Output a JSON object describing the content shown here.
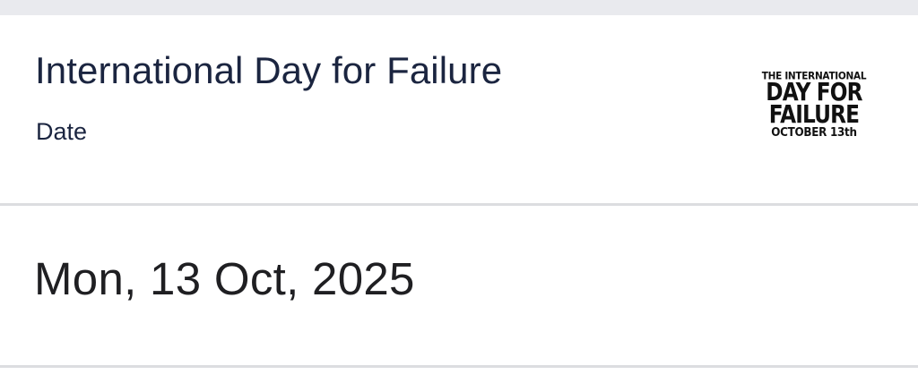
{
  "event": {
    "title": "International Day for Failure",
    "subtitle": "Date",
    "date_value": "Mon, 13 Oct, 2025"
  },
  "logo": {
    "line1": "THE INTERNATIONAL",
    "line2": "DAY FOR",
    "line3": "FAILURE",
    "line4": "OCTOBER 13th"
  },
  "colors": {
    "title_text": "#1b2540",
    "date_text": "#1f1f22",
    "top_strip": "#e9eaee",
    "divider": "#dcdde0"
  }
}
